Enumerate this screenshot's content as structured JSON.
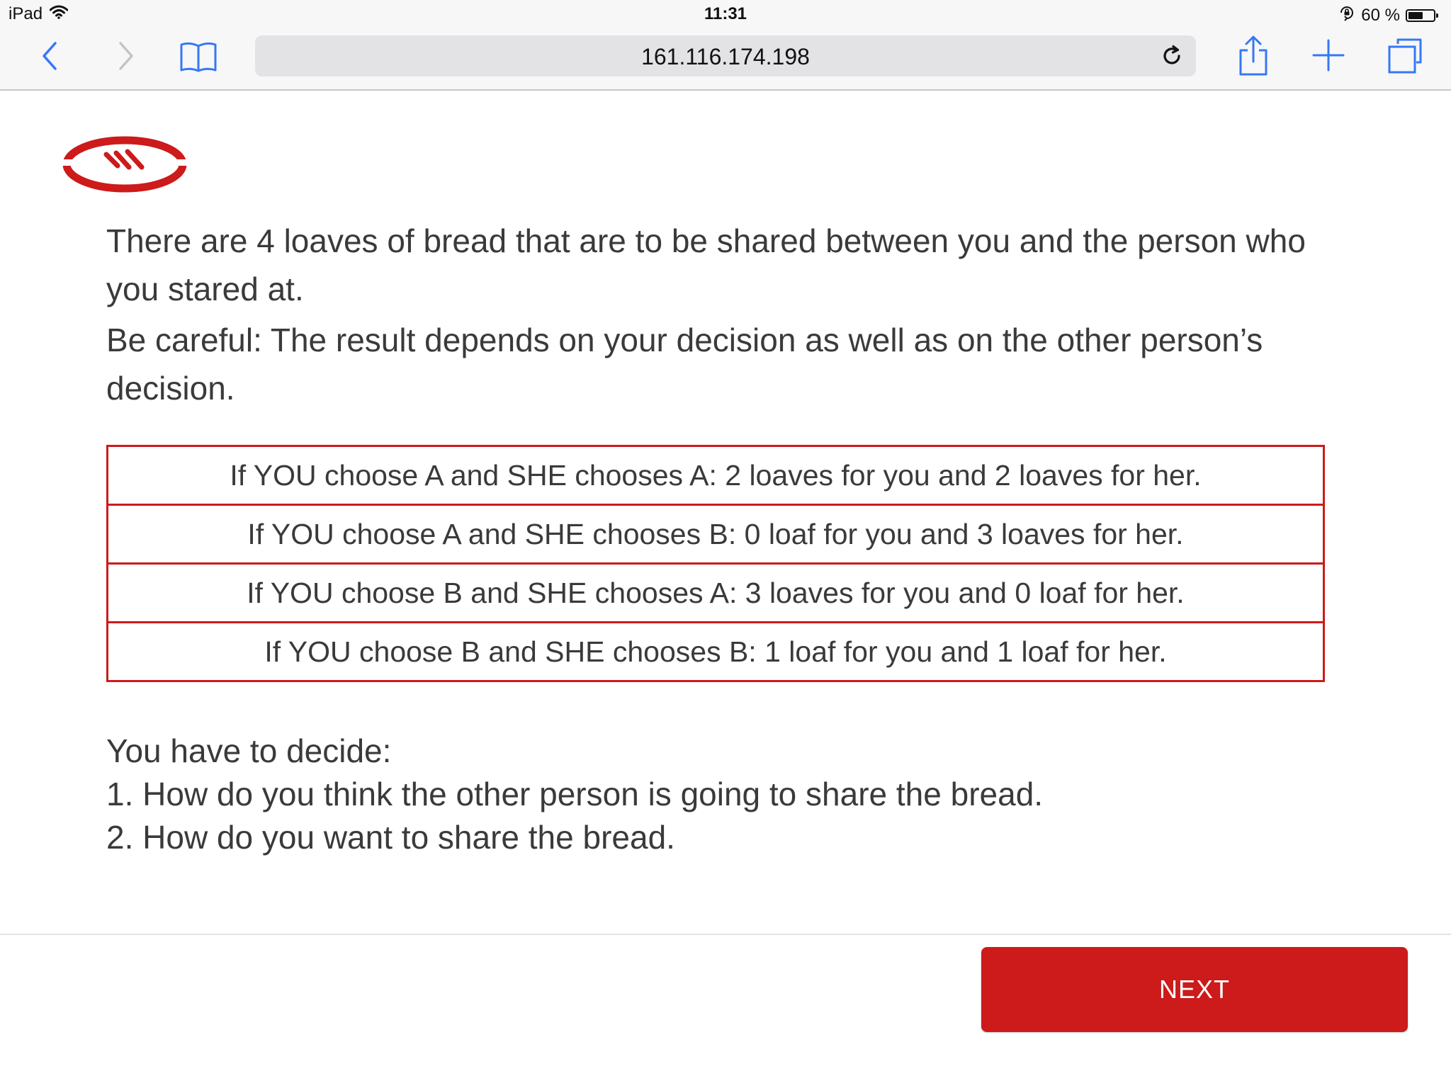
{
  "status_bar": {
    "device": "iPad",
    "time": "11:31",
    "battery": "60 %",
    "battery_level": 0.6
  },
  "browser": {
    "url": "161.116.174.198",
    "icons": {
      "back": "chevron-left-icon",
      "forward": "chevron-right-icon",
      "bookmarks": "book-icon",
      "reload": "reload-icon",
      "share": "share-icon",
      "new_tab": "plus-icon",
      "tabs": "tabs-icon"
    }
  },
  "page": {
    "intro": [
      "There are 4 loaves of bread that are to be shared between you and the person who you stared at.",
      "Be careful: The result depends on your decision as well as on the other person’s decision."
    ],
    "outcomes": [
      "If YOU choose A and SHE chooses A: 2 loaves for you and 2 loaves for her.",
      "If YOU choose A and SHE chooses B: 0 loaf for you and 3 loaves for her.",
      "If YOU choose B and SHE chooses A: 3 loaves for you and 0 loaf for her.",
      "If YOU choose B and SHE chooses B: 1 loaf for you and 1 loaf for her."
    ],
    "decide": {
      "heading": "You have to decide:",
      "items": [
        "1. How do you think the other person is going to share the bread.",
        "2. How do you want to share the bread."
      ]
    },
    "next_label": "NEXT"
  },
  "colors": {
    "accent": "#cd1a1a",
    "text": "#3a3a3a",
    "ios_blue": "#3478f6"
  }
}
